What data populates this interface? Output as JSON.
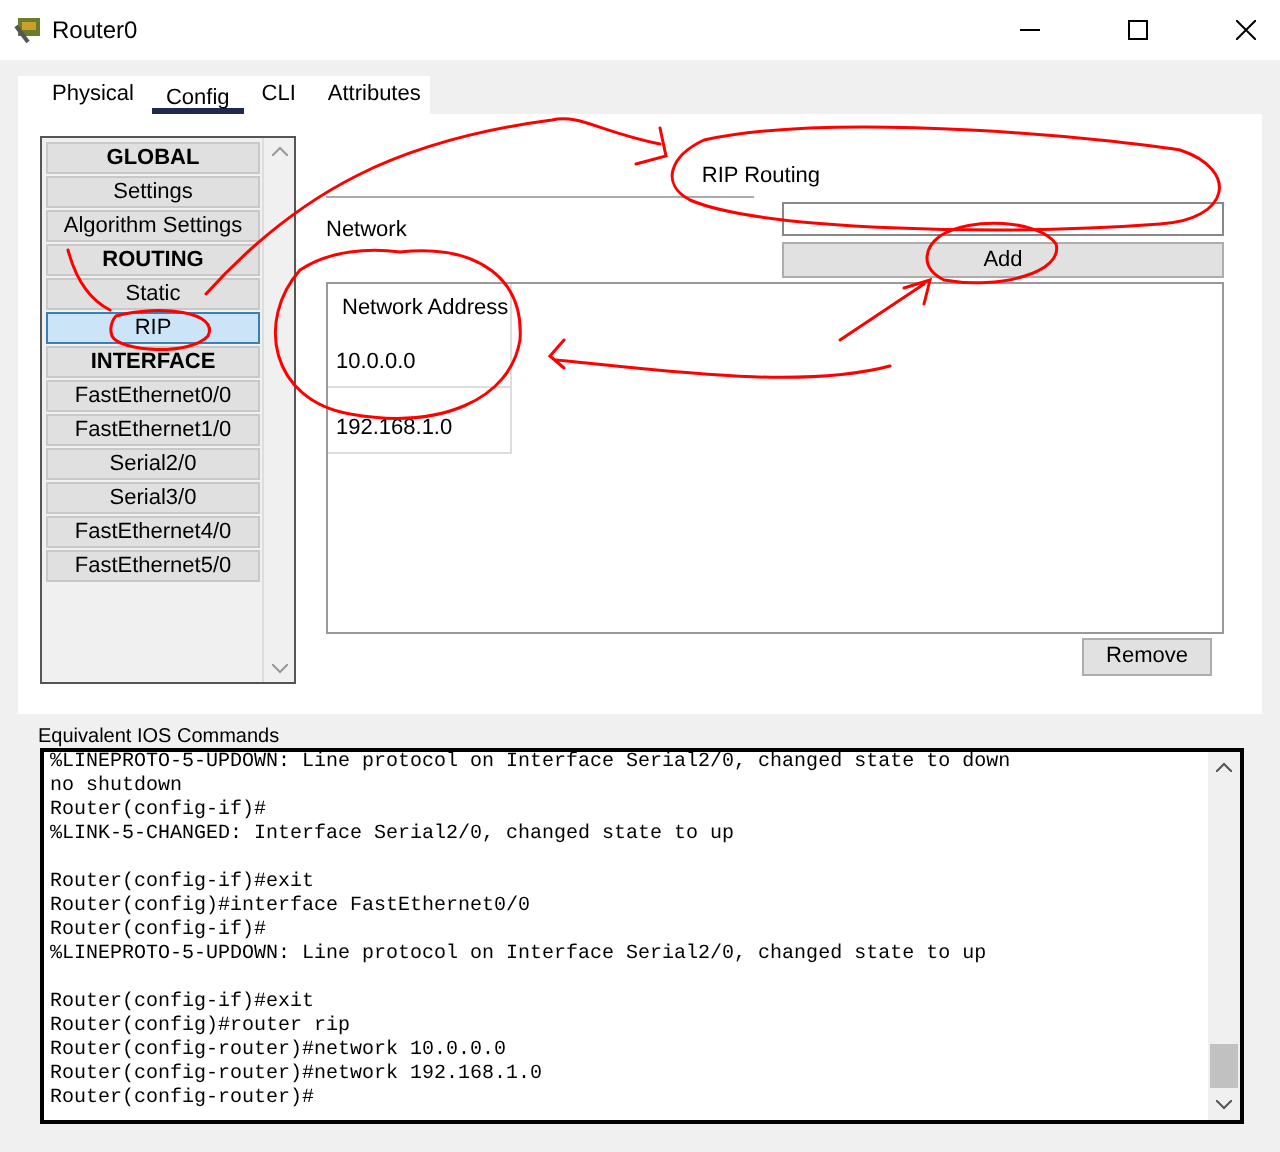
{
  "window": {
    "title": "Router0"
  },
  "tabs": [
    {
      "label": "Physical",
      "selected": false
    },
    {
      "label": "Config",
      "selected": true
    },
    {
      "label": "CLI",
      "selected": false
    },
    {
      "label": "Attributes",
      "selected": false
    }
  ],
  "sidebar": {
    "items": [
      {
        "label": "GLOBAL",
        "kind": "header"
      },
      {
        "label": "Settings",
        "kind": "item",
        "selected": false
      },
      {
        "label": "Algorithm Settings",
        "kind": "item",
        "selected": false
      },
      {
        "label": "ROUTING",
        "kind": "header"
      },
      {
        "label": "Static",
        "kind": "item",
        "selected": false
      },
      {
        "label": "RIP",
        "kind": "item",
        "selected": true
      },
      {
        "label": "INTERFACE",
        "kind": "header"
      },
      {
        "label": "FastEthernet0/0",
        "kind": "item",
        "selected": false
      },
      {
        "label": "FastEthernet1/0",
        "kind": "item",
        "selected": false
      },
      {
        "label": "Serial2/0",
        "kind": "item",
        "selected": false
      },
      {
        "label": "Serial3/0",
        "kind": "item",
        "selected": false
      },
      {
        "label": "FastEthernet4/0",
        "kind": "item",
        "selected": false
      },
      {
        "label": "FastEthernet5/0",
        "kind": "item",
        "selected": false
      }
    ]
  },
  "panel": {
    "title": "RIP Routing",
    "network_label": "Network",
    "add_button": "Add",
    "table": {
      "column": "Network Address",
      "rows": [
        "10.0.0.0",
        "192.168.1.0"
      ]
    },
    "remove_button": "Remove"
  },
  "console": {
    "label": "Equivalent IOS Commands",
    "blocks": [
      [
        "%LINEPROTO-5-UPDOWN: Line protocol on Interface Serial2/0, changed state to down",
        "no shutdown",
        "Router(config-if)#",
        "%LINK-5-CHANGED: Interface Serial2/0, changed state to up"
      ],
      [
        "Router(config-if)#exit",
        "Router(config)#interface FastEthernet0/0",
        "Router(config-if)#",
        "%LINEPROTO-5-UPDOWN: Line protocol on Interface Serial2/0, changed state to up"
      ],
      [
        "Router(config-if)#exit",
        "Router(config)#router rip",
        "Router(config-router)#network 10.0.0.0",
        "Router(config-router)#network 192.168.1.0",
        "Router(config-router)#"
      ]
    ]
  }
}
